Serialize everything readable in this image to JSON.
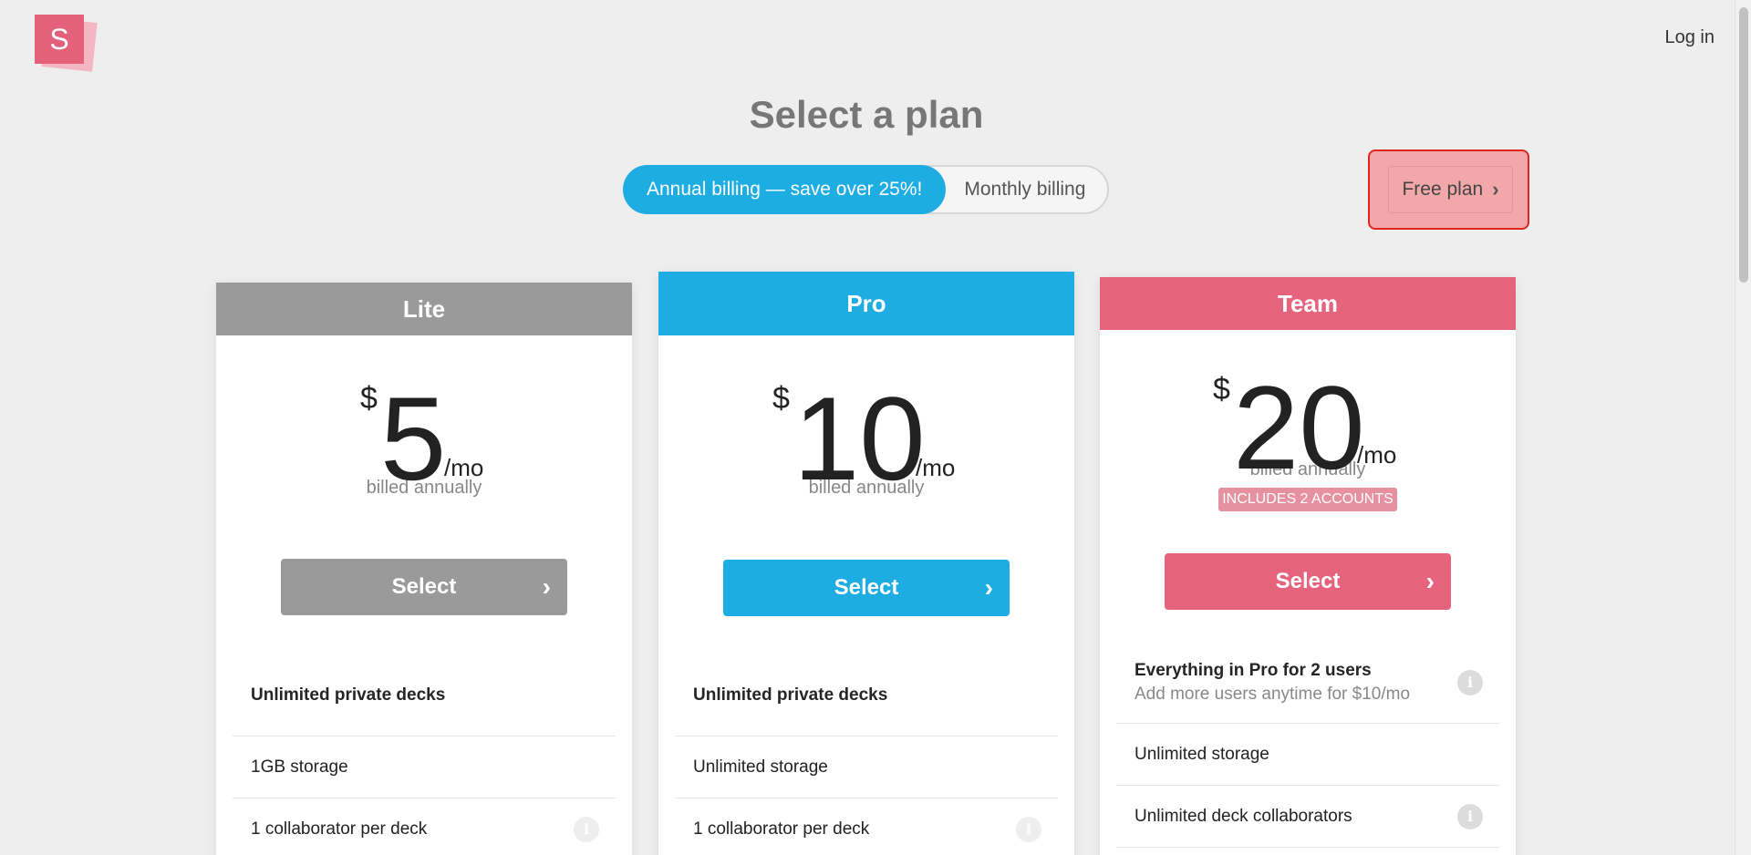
{
  "header": {
    "logo_letter": "S",
    "login_label": "Log in"
  },
  "main": {
    "title": "Select a plan",
    "billing": {
      "annual_label": "Annual billing — save over 25%!",
      "monthly_label": "Monthly billing",
      "selected": "annual"
    },
    "free_plan_label": "Free plan"
  },
  "plans": [
    {
      "name": "Lite",
      "currency": "$",
      "amount": "5",
      "per": "/mo",
      "billed": "billed annually",
      "select_label": "Select",
      "features": [
        {
          "main": "Unlimited private decks"
        },
        {
          "main": "1GB storage"
        },
        {
          "main": "1 collaborator per deck",
          "icon": "info-icon"
        }
      ],
      "color": "#9a9a9a"
    },
    {
      "name": "Pro",
      "currency": "$",
      "amount": "10",
      "per": "/mo",
      "billed": "billed annually",
      "select_label": "Select",
      "features": [
        {
          "main": "Unlimited private decks"
        },
        {
          "main": "Unlimited storage"
        },
        {
          "main": "1 collaborator per deck",
          "icon": "info-icon"
        }
      ],
      "color": "#1dade2"
    },
    {
      "name": "Team",
      "currency": "$",
      "amount": "20",
      "per": "/mo",
      "billed": "billed annually",
      "badge": "INCLUDES 2 ACCOUNTS",
      "select_label": "Select",
      "features": [
        {
          "main": "Everything in Pro for 2 users",
          "sub": "Add more users anytime for $10/mo",
          "icon": "info-icon"
        },
        {
          "main": "Unlimited storage"
        },
        {
          "main": "Unlimited deck collaborators",
          "icon": "info-icon"
        }
      ],
      "color": "#e5637c"
    }
  ],
  "icons": {
    "chevron": "chevron-right-icon",
    "info": "info-icon",
    "info_glyph": "i",
    "chevron_glyph": "›"
  }
}
